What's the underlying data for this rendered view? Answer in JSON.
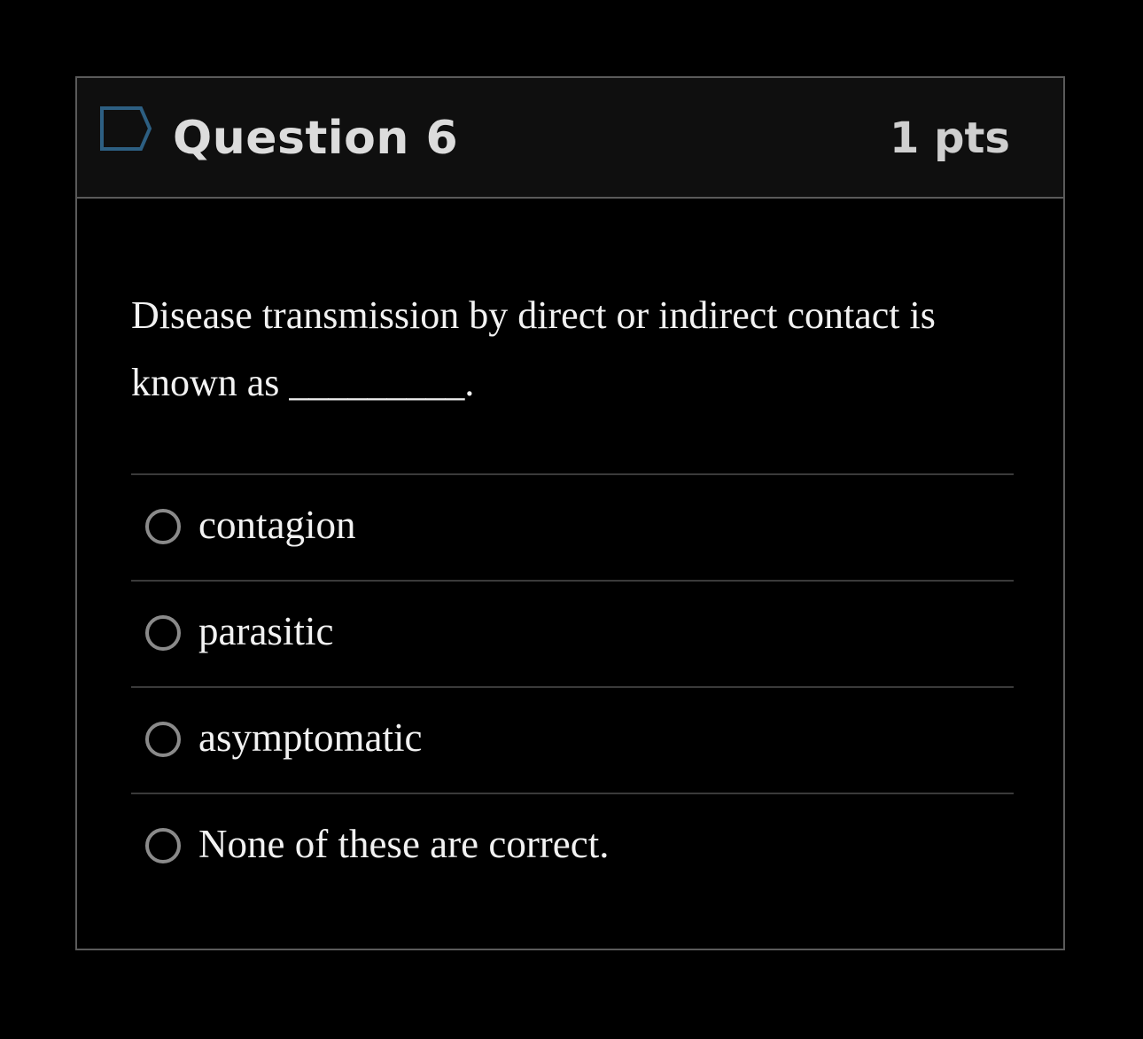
{
  "question": {
    "title": "Question 6",
    "points": "1 pts",
    "flag_icon": "flag-outline-icon",
    "text": "Disease transmission by direct or indirect contact is known as _________.",
    "accent_color": "#2d5f82"
  },
  "answers": [
    {
      "label": "contagion",
      "selected": false
    },
    {
      "label": "parasitic",
      "selected": false
    },
    {
      "label": "asymptomatic",
      "selected": false
    },
    {
      "label": "None of these are correct.",
      "selected": false
    }
  ]
}
